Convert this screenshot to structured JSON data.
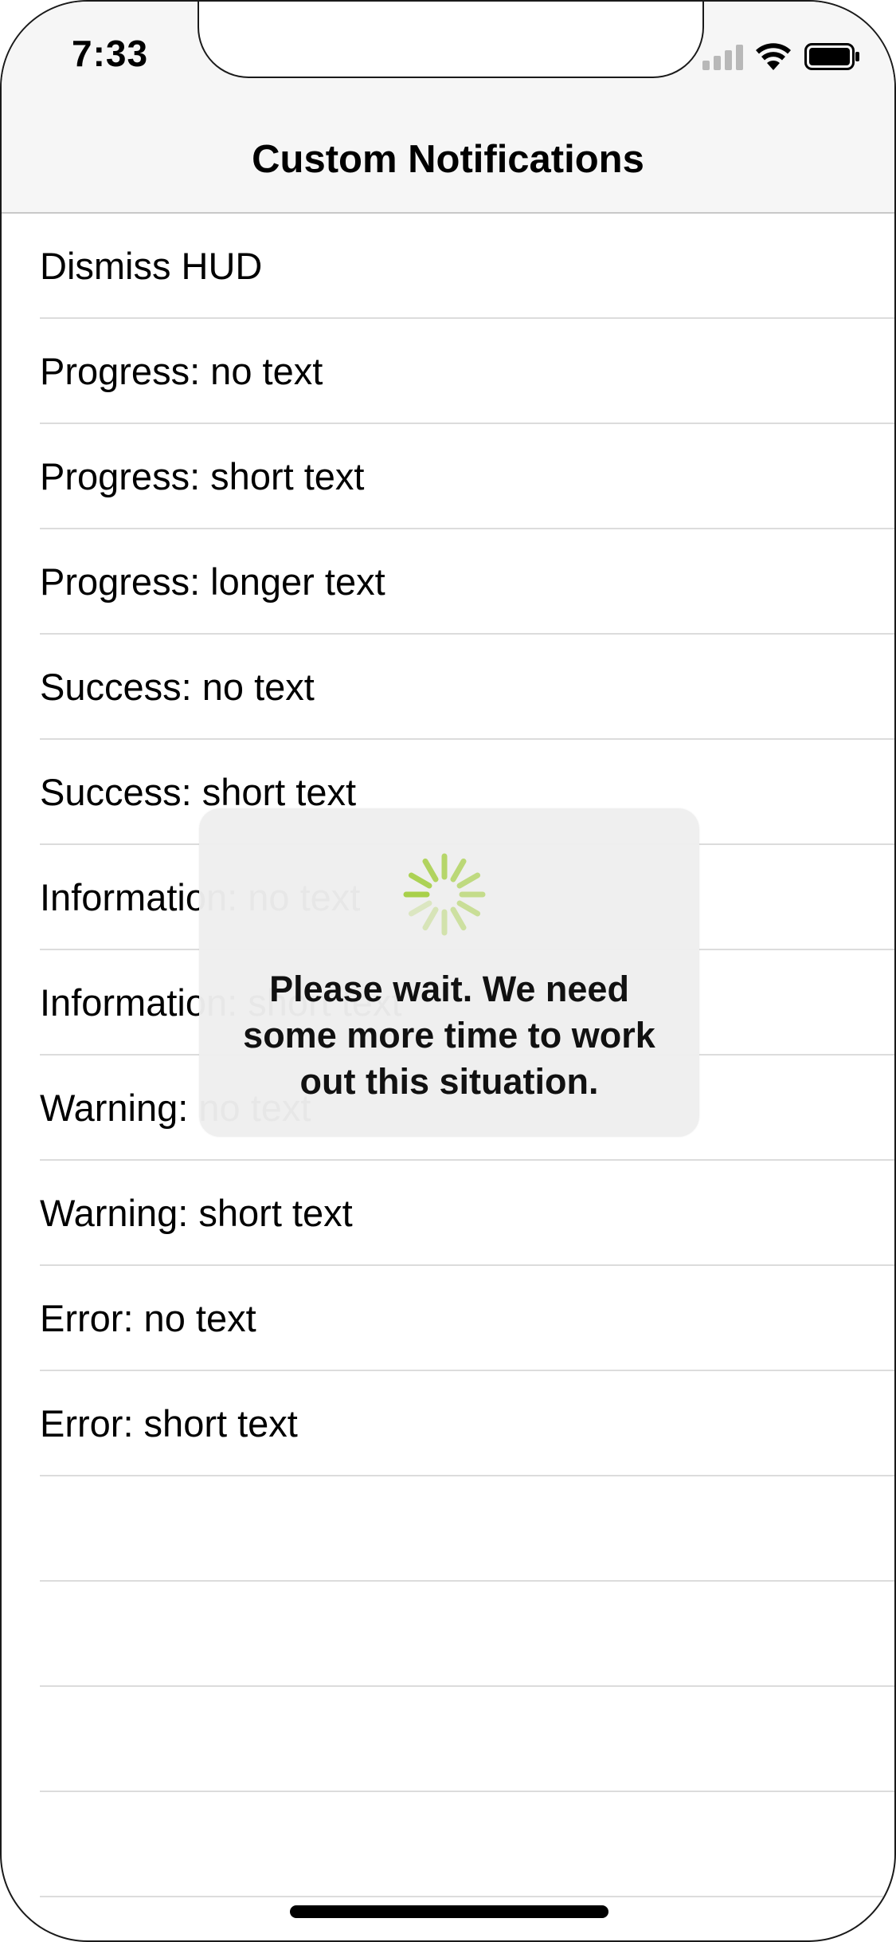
{
  "status_bar": {
    "time": "7:33",
    "icons": [
      "signal-icon",
      "wifi-icon",
      "battery-icon"
    ]
  },
  "nav": {
    "title": "Custom Notifications"
  },
  "list": {
    "items": [
      {
        "label": "Dismiss HUD"
      },
      {
        "label": "Progress: no text"
      },
      {
        "label": "Progress: short text"
      },
      {
        "label": "Progress: longer text"
      },
      {
        "label": "Success: no text"
      },
      {
        "label": "Success: short text"
      },
      {
        "label": "Information: no text"
      },
      {
        "label": "Information: short text"
      },
      {
        "label": "Warning: no text"
      },
      {
        "label": "Warning: short text"
      },
      {
        "label": "Error: no text"
      },
      {
        "label": "Error: short text"
      }
    ]
  },
  "hud": {
    "message": "Please wait. We need some more time to work out this situation.",
    "icon": "spinner-icon",
    "spinner_color": "#a8d04a"
  },
  "colors": {
    "header_bg": "#f6f6f6",
    "separator": "#dcdcdc",
    "hud_bg": "#eeeeee"
  }
}
